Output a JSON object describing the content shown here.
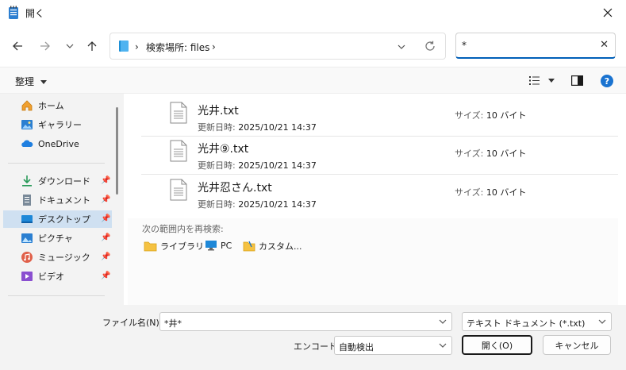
{
  "window": {
    "title": "開く"
  },
  "nav": {
    "breadcrumb": [
      "検索場所: files"
    ]
  },
  "search": {
    "value": "*"
  },
  "commandbar": {
    "organize_label": "整理"
  },
  "sidebar": {
    "items": [
      {
        "label": "ホーム",
        "icon": "home-icon",
        "pinned": false
      },
      {
        "label": "ギャラリー",
        "icon": "gallery-icon",
        "pinned": false
      },
      {
        "label": "OneDrive",
        "icon": "onedrive-cloud-icon",
        "pinned": false
      },
      {
        "label": "ダウンロード",
        "icon": "download-icon",
        "pinned": true
      },
      {
        "label": "ドキュメント",
        "icon": "document-icon",
        "pinned": true
      },
      {
        "label": "デスクトップ",
        "icon": "desktop-icon",
        "pinned": true,
        "selected": true
      },
      {
        "label": "ピクチャ",
        "icon": "pictures-icon",
        "pinned": true
      },
      {
        "label": "ミュージック",
        "icon": "music-icon",
        "pinned": true
      },
      {
        "label": "ビデオ",
        "icon": "video-icon",
        "pinned": true
      }
    ]
  },
  "files": [
    {
      "name": "光井.txt",
      "modified_label": "更新日時:",
      "modified": "2025/10/21 14:37",
      "size_label": "サイズ:",
      "size": "10 バイト"
    },
    {
      "name": "光井⑨.txt",
      "modified_label": "更新日時:",
      "modified": "2025/10/21 14:37",
      "size_label": "サイズ:",
      "size": "10 バイト"
    },
    {
      "name": "光井忍さん.txt",
      "modified_label": "更新日時:",
      "modified": "2025/10/21 14:37",
      "size_label": "サイズ:",
      "size": "10 バイト"
    }
  ],
  "search_again": {
    "label": "次の範囲内を再検索:",
    "items": [
      "ライブラリ",
      "PC",
      "カスタム..."
    ]
  },
  "footer": {
    "filename_label": "ファイル名(N):",
    "filename_value": "*井*",
    "filetype_value": "テキスト ドキュメント (*.txt)",
    "encoding_label": "エンコード:",
    "encoding_value": "自動検出",
    "open_button": "開く(O)",
    "cancel_button": "キャンセル"
  },
  "colors": {
    "accent": "#005fb8",
    "selection": "#cfe0f1"
  }
}
